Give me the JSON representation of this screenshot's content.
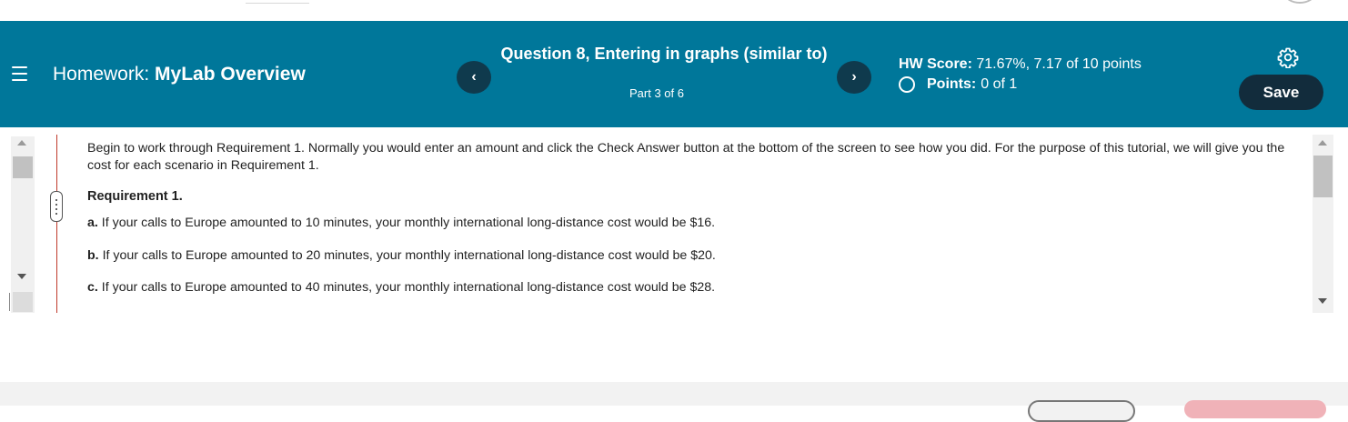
{
  "header": {
    "homework_prefix": "Homework:",
    "homework_name": "MyLab Overview",
    "question_title": "Question 8, Entering in graphs (similar to)",
    "part": "Part 3 of 6",
    "prev_label": "‹",
    "next_label": "›",
    "hw_score_label": "HW Score:",
    "hw_score_value": "71.67%, 7.17 of 10 points",
    "points_label": "Points:",
    "points_value": "0 of 1",
    "save_label": "Save"
  },
  "content": {
    "intro": "Begin to work through Requirement 1. Normally you would enter an amount and click the Check Answer button at the bottom of the screen to see how you did. For the purpose of this tutorial, we will give you the cost for each scenario in Requirement 1.",
    "requirement_title": "Requirement 1.",
    "items": [
      {
        "letter": "a.",
        "text": "If your calls to Europe amounted to 10 minutes, your monthly international long-distance cost would be $16."
      },
      {
        "letter": "b.",
        "text": "If your calls to Europe amounted to 20 minutes, your monthly international long-distance cost would be $20."
      },
      {
        "letter": "c.",
        "text": "If your calls to Europe amounted to 40 minutes, your monthly international long-distance cost would be $28."
      }
    ]
  },
  "colors": {
    "header_bg": "#00779a",
    "nav_button_bg": "#0f3a4d",
    "save_button_bg": "#122c3c"
  },
  "icons": [
    "hamburger-menu-icon",
    "gear-icon",
    "chevron-left-icon",
    "chevron-right-icon",
    "radio-empty-icon"
  ]
}
